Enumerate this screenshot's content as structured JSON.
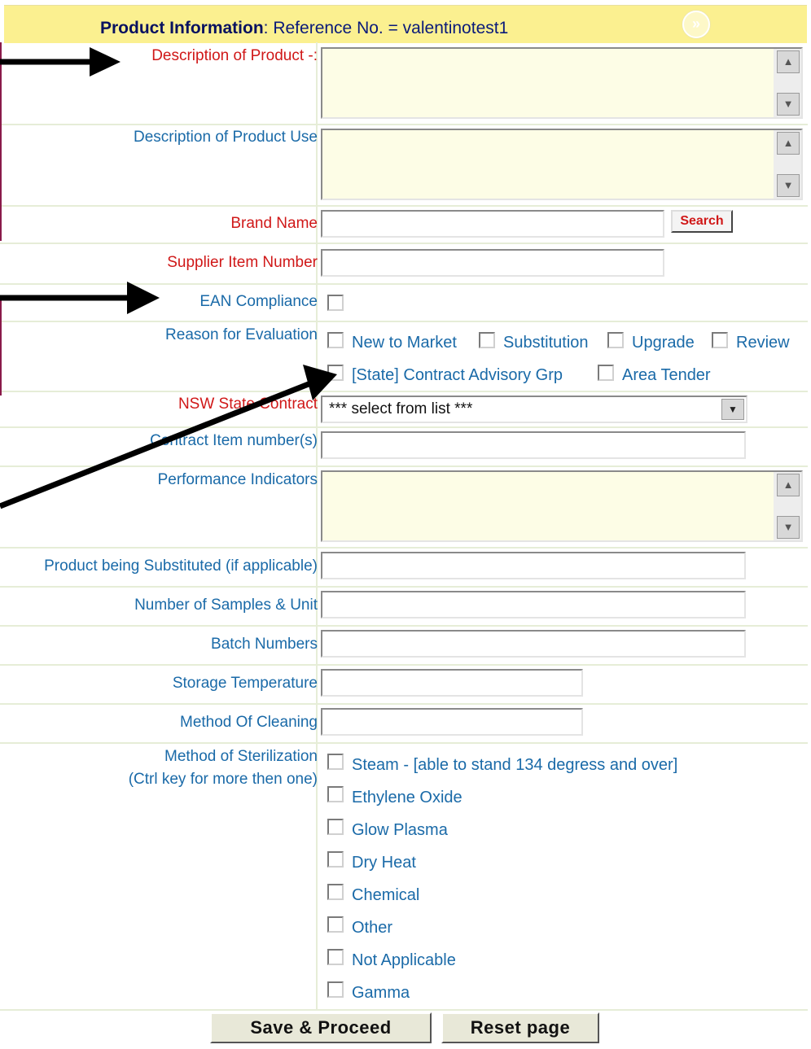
{
  "header": {
    "title_bold": "Product Information",
    "title_rest": ": Reference No. = valentinotest1",
    "nav_icon": "double-chevron-right-icon"
  },
  "fields": {
    "description_of_product": "Description of Product -:",
    "description_of_product_use": "Description of Product Use",
    "brand_name": "Brand Name",
    "supplier_item_number": "Supplier Item Number",
    "ean_compliance": "EAN Compliance",
    "reason_for_evaluation": "Reason for Evaluation",
    "nsw_state_contract": "NSW State Contract",
    "contract_item_numbers": "Contract Item number(s)",
    "performance_indicators": "Performance Indicators",
    "product_being_substituted": "Product being Substituted (if applicable)",
    "number_of_samples": "Number of Samples & Unit",
    "batch_numbers": "Batch Numbers",
    "storage_temperature": "Storage Temperature",
    "method_of_cleaning": "Method Of Cleaning",
    "method_of_sterilization_1": "Method of Sterilization",
    "method_of_sterilization_2": "(Ctrl key for more then one)"
  },
  "search_button": "Search",
  "reasons": [
    "New to Market",
    "Substitution",
    "Upgrade",
    "Review",
    "[State] Contract Advisory Grp",
    "Area Tender"
  ],
  "contract_select": {
    "selected": "*** select from list ***"
  },
  "sterilization_options": [
    "Steam - [able to stand 134 degress and over]",
    "Ethylene Oxide",
    "Glow Plasma",
    "Dry Heat",
    "Chemical",
    "Other",
    "Not Applicable",
    "Gamma"
  ],
  "buttons": {
    "save": "Save & Proceed",
    "reset": "Reset page"
  },
  "scroll_icons": {
    "up": "▲",
    "down": "▼"
  },
  "select_arrow": "▼",
  "colors": {
    "header_bg": "#fbf090",
    "label_blue": "#1a6aa8",
    "label_red": "#d01818",
    "textarea_bg": "#fdfde6"
  }
}
